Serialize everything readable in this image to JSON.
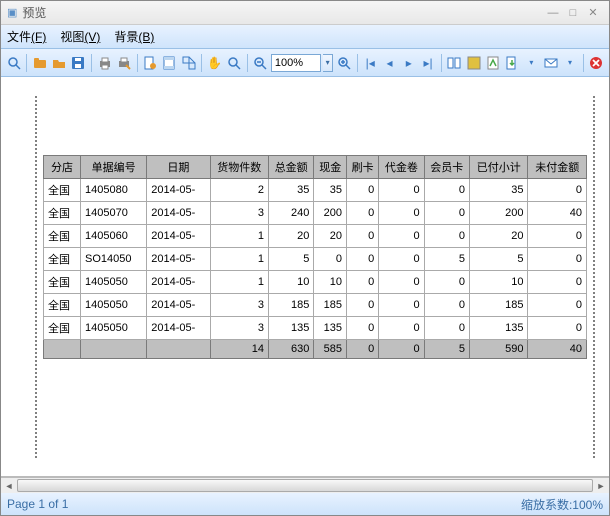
{
  "window": {
    "title": "预览"
  },
  "menu": {
    "file": "文件",
    "file_s": "(F)",
    "view": "视图",
    "view_s": "(V)",
    "bg": "背景",
    "bg_s": "(B)"
  },
  "toolbar": {
    "zoom_value": "100%"
  },
  "table": {
    "headers": [
      "分店",
      "单据编号",
      "日期",
      "货物件数",
      "总金额",
      "现金",
      "刷卡",
      "代金卷",
      "会员卡",
      "已付小计",
      "未付金额"
    ],
    "rows": [
      [
        "全国",
        "1405080",
        "2014-05-",
        "2",
        "35",
        "35",
        "0",
        "0",
        "0",
        "35",
        "0"
      ],
      [
        "全国",
        "1405070",
        "2014-05-",
        "3",
        "240",
        "200",
        "0",
        "0",
        "0",
        "200",
        "40"
      ],
      [
        "全国",
        "1405060",
        "2014-05-",
        "1",
        "20",
        "20",
        "0",
        "0",
        "0",
        "20",
        "0"
      ],
      [
        "全国",
        "SO14050",
        "2014-05-",
        "1",
        "5",
        "0",
        "0",
        "0",
        "5",
        "5",
        "0"
      ],
      [
        "全国",
        "1405050",
        "2014-05-",
        "1",
        "10",
        "10",
        "0",
        "0",
        "0",
        "10",
        "0"
      ],
      [
        "全国",
        "1405050",
        "2014-05-",
        "3",
        "185",
        "185",
        "0",
        "0",
        "0",
        "185",
        "0"
      ],
      [
        "全国",
        "1405050",
        "2014-05-",
        "3",
        "135",
        "135",
        "0",
        "0",
        "0",
        "135",
        "0"
      ]
    ],
    "totals": [
      "",
      "",
      "",
      "14",
      "630",
      "585",
      "0",
      "0",
      "5",
      "590",
      "40"
    ]
  },
  "status": {
    "page": "Page 1 of 1",
    "zoom": "缩放系数:100%"
  }
}
